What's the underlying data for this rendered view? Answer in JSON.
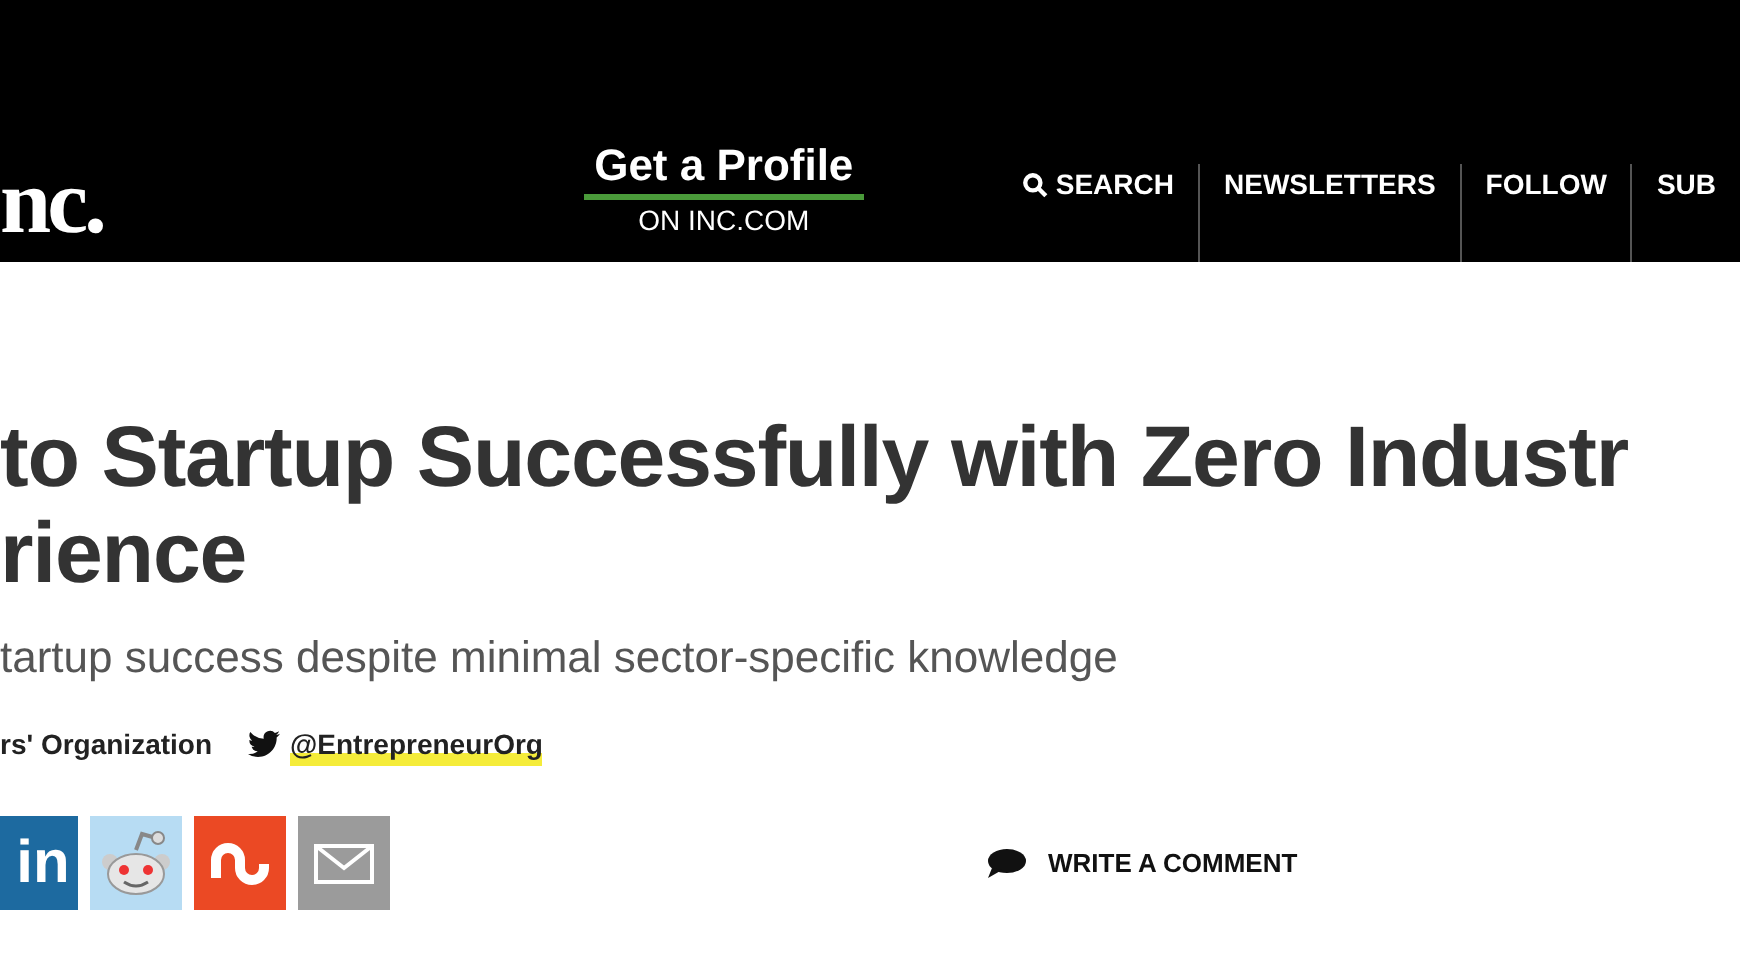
{
  "header": {
    "logo": "nc.",
    "promo": {
      "title": "Get a Profile",
      "subtitle": "ON INC.COM"
    },
    "nav": [
      {
        "label": "SEARCH",
        "kind": "search"
      },
      {
        "label": "NEWSLETTERS",
        "kind": "link"
      },
      {
        "label": "FOLLOW",
        "kind": "link"
      },
      {
        "label": "SUB",
        "kind": "link"
      }
    ]
  },
  "article": {
    "title_lines": [
      "to Startup Successfully with Zero Industr",
      "rience"
    ],
    "subtitle": "tartup success despite minimal sector-specific knowledge",
    "author": "rs' Organization",
    "twitter_handle": "@EntrepreneurOrg"
  },
  "share": [
    {
      "kind": "linkedin",
      "label": "in"
    },
    {
      "kind": "reddit"
    },
    {
      "kind": "stumbleupon"
    },
    {
      "kind": "email"
    }
  ],
  "comment_button": "WRITE A COMMENT"
}
